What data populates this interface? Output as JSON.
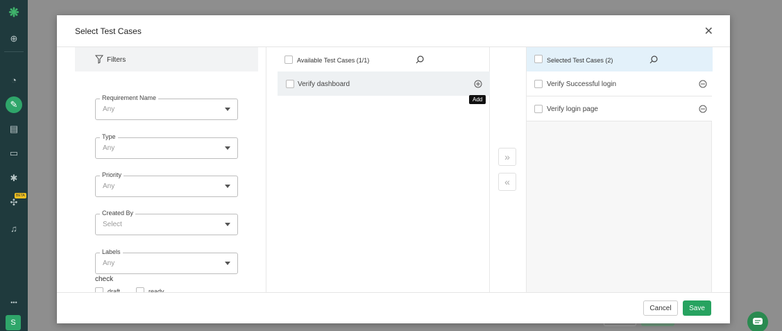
{
  "colors": {
    "rail": "#1f3a3d",
    "accent": "#27a360",
    "selected_header": "#e3f1fa"
  },
  "rail": {
    "items": [
      {
        "name": "logo-icon",
        "glyph": "❋"
      },
      {
        "name": "add-icon",
        "glyph": "⊕"
      },
      {
        "name": "dashboard-icon",
        "glyph": "◔"
      },
      {
        "name": "edit-icon",
        "glyph": "✎"
      },
      {
        "name": "briefcase-icon",
        "glyph": "▤"
      },
      {
        "name": "monitor-icon",
        "glyph": "▭"
      },
      {
        "name": "bug-icon",
        "glyph": "✱"
      },
      {
        "name": "puzzle-icon",
        "glyph": "✣"
      },
      {
        "name": "bell-icon",
        "glyph": "♫"
      },
      {
        "name": "more-icon",
        "glyph": "•••"
      }
    ],
    "beta_label": "BETA",
    "avatar_letter": "S"
  },
  "modal": {
    "title": "Select Test Cases"
  },
  "filters": {
    "heading": "Filters",
    "fields": [
      {
        "label": "Requirement Name",
        "value": "Any"
      },
      {
        "label": "Type",
        "value": "Any"
      },
      {
        "label": "Priority",
        "value": "Any"
      },
      {
        "label": "Created By",
        "value": "Select"
      },
      {
        "label": "Labels",
        "value": "Any"
      }
    ],
    "check_label": "check",
    "check_options": [
      "draft",
      "ready"
    ]
  },
  "available": {
    "title": "Available Test Cases (1/1)",
    "items": [
      "Verify dashboard"
    ],
    "tooltip": "Add"
  },
  "transfer": {
    "move_right": "»",
    "move_left": "«"
  },
  "selected": {
    "title": "Selected Test Cases (2)",
    "items": [
      "Verify Successful login",
      "Verify login page"
    ]
  },
  "footer": {
    "cancel_label": "Cancel",
    "save_label": "Save"
  }
}
